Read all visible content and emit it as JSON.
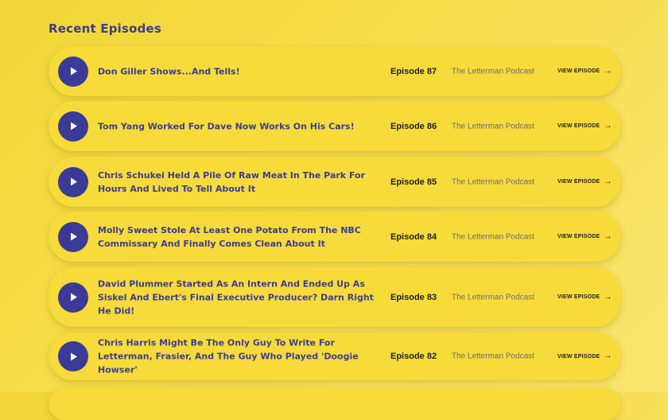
{
  "section": {
    "title": "Recent Episodes"
  },
  "episodes": [
    {
      "title": "Don Giller Shows...And Tells!",
      "number": "Episode 87",
      "podcast": "The Letterman Podcast",
      "link": "VIEW EPISODE",
      "icon": "arrow-right-icon"
    },
    {
      "title": "Tom Yang Worked For Dave Now Works On His Cars!",
      "number": "Episode 86",
      "podcast": "The Letterman Podcast",
      "link": "VIEW EPISODE",
      "icon": "arrow-right-icon"
    },
    {
      "title": "Chris Schukei Held A Pile Of Raw Meat In The Park For Hours And Lived To Tell About It",
      "number": "Episode 85",
      "podcast": "The Letterman Podcast",
      "link": "VIEW EPISODE",
      "icon": "arrow-right-icon"
    },
    {
      "title": "Molly Sweet Stole At Least One Potato From The NBC Commissary And Finally Comes Clean About It",
      "number": "Episode 84",
      "podcast": "The Letterman Podcast",
      "link": "VIEW EPISODE",
      "icon": "arrow-right-icon"
    },
    {
      "title": "David Plummer Started As An Intern And Ended Up As Siskel And Ebert's Final Executive Producer? Darn Right He Did!",
      "number": "Episode 83",
      "podcast": "The Letterman Podcast",
      "link": "VIEW EPISODE",
      "icon": "arrow-right-icon"
    },
    {
      "title": "Chris Harris Might Be The Only Guy To Write For Letterman, Frasier, And The Guy Who Played 'Doogie Howser'",
      "number": "Episode 82",
      "podcast": "The Letterman Podcast",
      "link": "VIEW EPISODE",
      "icon": "arrow-right-icon"
    }
  ],
  "colors": {
    "background": "#f4d93f",
    "card": "#f6db3b",
    "accent": "#3b3a96",
    "title_text": "#3d3d8f"
  }
}
